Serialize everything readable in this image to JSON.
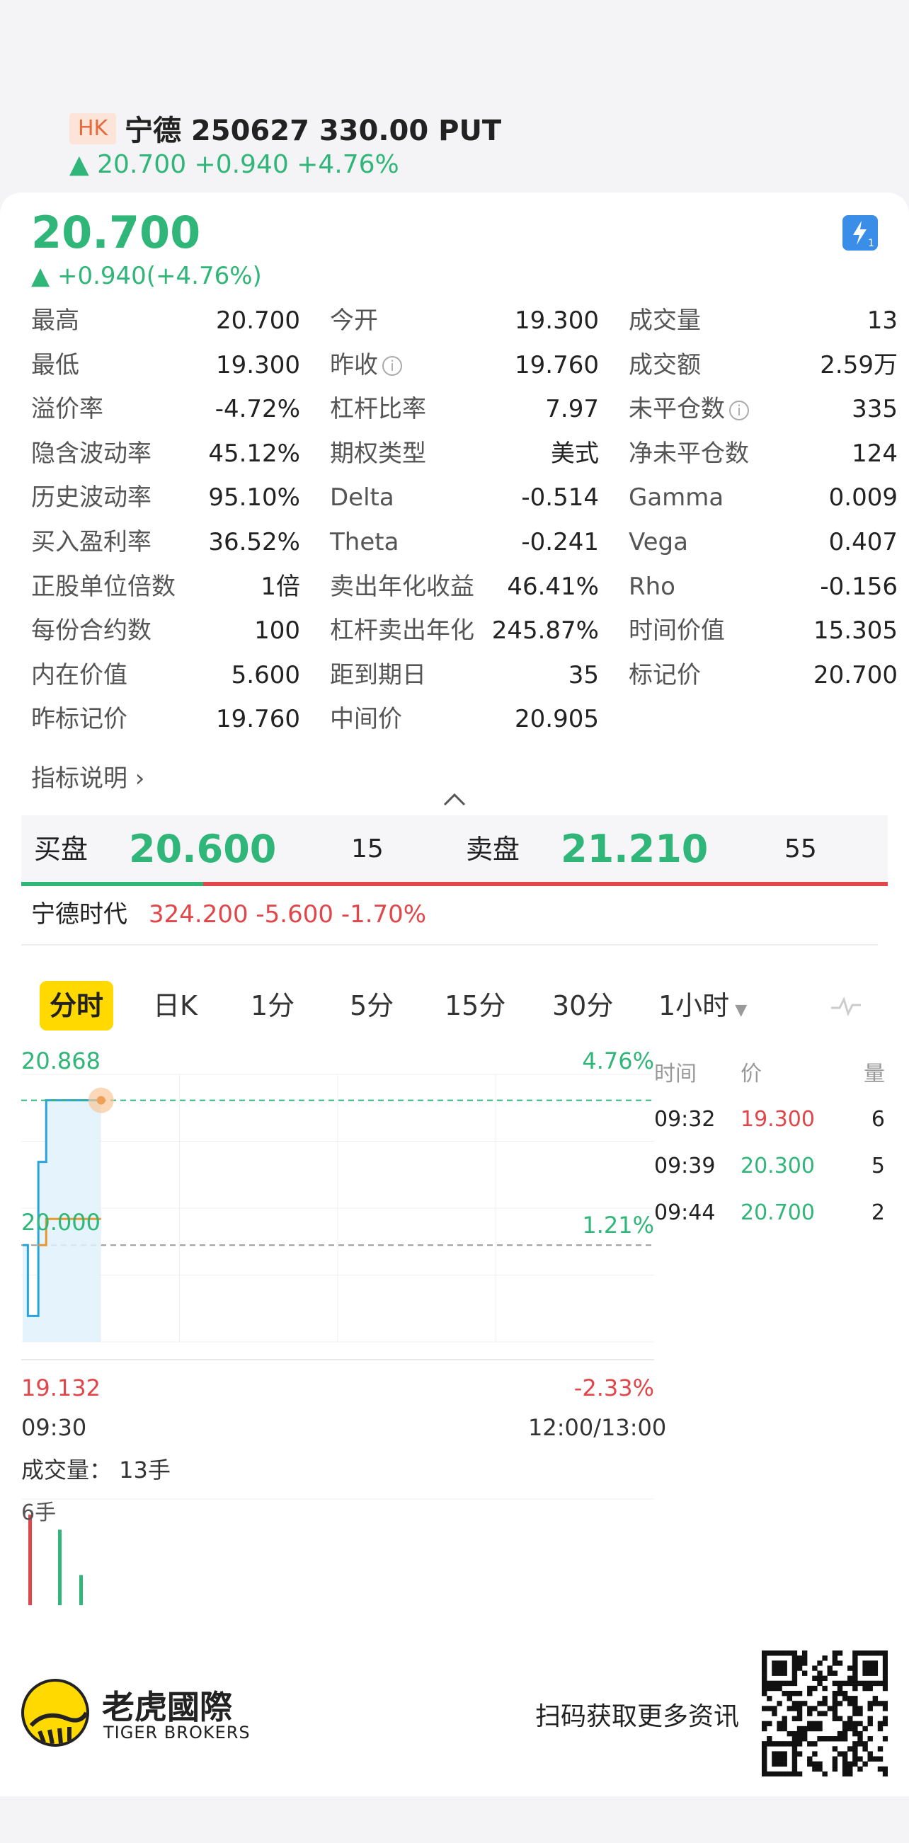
{
  "header": {
    "market": "HK",
    "title": "宁德 250627 330.00 PUT",
    "quote": "▲ 20.700 +0.940 +4.76%"
  },
  "price": {
    "last": "20.700",
    "change": "▲ +0.940(+4.76%)"
  },
  "stats": [
    [
      {
        "label": "最高",
        "value": "20.700"
      },
      {
        "label": "今开",
        "value": "19.300"
      },
      {
        "label": "成交量",
        "value": "13"
      }
    ],
    [
      {
        "label": "最低",
        "value": "19.300"
      },
      {
        "label": "昨收",
        "value": "19.760",
        "info": true
      },
      {
        "label": "成交额",
        "value": "2.59万"
      }
    ],
    [
      {
        "label": "溢价率",
        "value": "-4.72%"
      },
      {
        "label": "杠杆比率",
        "value": "7.97"
      },
      {
        "label": "未平仓数",
        "value": "335",
        "info": true
      }
    ],
    [
      {
        "label": "隐含波动率",
        "value": "45.12%"
      },
      {
        "label": "期权类型",
        "value": "美式"
      },
      {
        "label": "净未平仓数",
        "value": "124"
      }
    ],
    [
      {
        "label": "历史波动率",
        "value": "95.10%"
      },
      {
        "label": "Delta",
        "value": "-0.514"
      },
      {
        "label": "Gamma",
        "value": "0.009"
      }
    ],
    [
      {
        "label": "买入盈利率",
        "value": "36.52%"
      },
      {
        "label": "Theta",
        "value": "-0.241"
      },
      {
        "label": "Vega",
        "value": "0.407"
      }
    ],
    [
      {
        "label": "正股单位倍数",
        "value": "1倍"
      },
      {
        "label": "卖出年化收益",
        "value": "46.41%"
      },
      {
        "label": "Rho",
        "value": "-0.156"
      }
    ],
    [
      {
        "label": "每份合约数",
        "value": "100"
      },
      {
        "label": "杠杆卖出年化",
        "value": "245.87%"
      },
      {
        "label": "时间价值",
        "value": "15.305"
      }
    ],
    [
      {
        "label": "内在价值",
        "value": "5.600"
      },
      {
        "label": "距到期日",
        "value": "35"
      },
      {
        "label": "标记价",
        "value": "20.700"
      }
    ],
    [
      {
        "label": "昨标记价",
        "value": "19.760"
      },
      {
        "label": "中间价",
        "value": "20.905"
      },
      null
    ]
  ],
  "indicator_link": "指标说明 ›",
  "collapse_icon": "chevron-up-icon",
  "orderbook": {
    "bid_label": "买盘",
    "bid_price": "20.600",
    "bid_qty": "15",
    "ask_label": "卖盘",
    "ask_price": "21.210",
    "ask_qty": "55",
    "bid_share": 0.21
  },
  "underlying": {
    "name": "宁德时代",
    "quote": "324.200 -5.600 -1.70%"
  },
  "tabs": [
    {
      "label": "分时",
      "active": true
    },
    {
      "label": "日K"
    },
    {
      "label": "1分"
    },
    {
      "label": "5分"
    },
    {
      "label": "15分"
    },
    {
      "label": "30分"
    },
    {
      "label": "1小时",
      "dropdown": true
    }
  ],
  "chart": {
    "y_high": "20.868",
    "y_mid": "20.000",
    "y_low": "19.132",
    "pct_high": "4.76%",
    "pct_mid": "1.21%",
    "pct_low": "-2.33%",
    "time_start": "09:30",
    "time_end": "12:00/13:00"
  },
  "chart_data": {
    "type": "line",
    "prev_close": 19.76,
    "ylim": [
      19.132,
      20.868
    ],
    "series": [
      {
        "values": [
          19.76,
          19.76,
          19.3,
          19.3,
          19.3,
          19.3,
          20.3,
          20.3,
          20.3,
          20.7,
          20.7,
          20.7,
          20.7,
          20.7,
          20.7,
          20.7,
          20.7,
          20.7,
          20.7,
          20.7,
          20.7,
          20.7,
          20.7,
          20.7,
          20.7,
          20.7,
          20.7,
          20.7,
          20.7,
          20.7,
          20.7
        ]
      },
      {
        "values": [
          null,
          null,
          null,
          null,
          null,
          null,
          19.76,
          19.76,
          19.76,
          19.93,
          19.93,
          19.93,
          19.93,
          19.93,
          19.93,
          19.93,
          19.93,
          19.93,
          19.93,
          19.93,
          19.93,
          19.93,
          19.93,
          19.93,
          19.93,
          19.93,
          19.93,
          19.93,
          19.93,
          19.93,
          19.93
        ]
      }
    ],
    "volume": [
      6,
      5,
      2
    ]
  },
  "colors": {
    "up": "#2fb678",
    "down": "#e0464a",
    "price_line": "#29a3dc",
    "avg_line": "#e8962e",
    "active_tab": "#ffd900"
  },
  "trades": {
    "headers": [
      "时间",
      "价",
      "量"
    ],
    "rows": [
      {
        "time": "09:32",
        "price": "19.300",
        "qty": "6",
        "color": "red"
      },
      {
        "time": "09:39",
        "price": "20.300",
        "qty": "5",
        "color": "green"
      },
      {
        "time": "09:44",
        "price": "20.700",
        "qty": "2",
        "color": "green"
      }
    ]
  },
  "volume": {
    "title": "成交量：  13手",
    "unit": "6手"
  },
  "footer": {
    "brand": "老虎國際",
    "brand_sub": "TIGER BROKERS",
    "cta": "扫码获取更多资讯"
  }
}
